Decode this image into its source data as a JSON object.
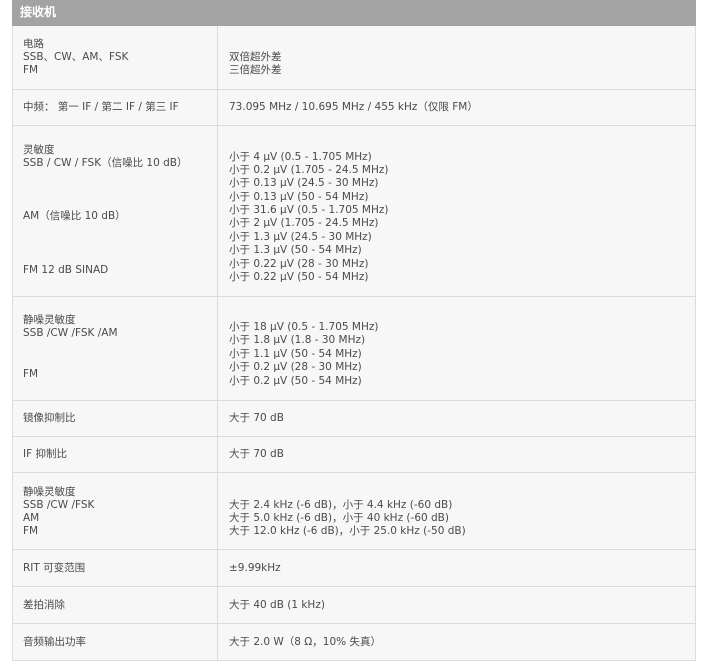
{
  "section_title": "接收机",
  "rows": [
    {
      "label": [
        "电路",
        "SSB、CW、AM、FSK",
        "FM"
      ],
      "value": [
        "双倍超外差",
        "三倍超外差"
      ]
    },
    {
      "label": [
        "中频： 第一 IF / 第二 IF / 第三 IF"
      ],
      "value": [
        "73.095 MHz / 10.695 MHz / 455 kHz（仅限 FM）"
      ]
    },
    {
      "label": [
        "灵敏度",
        "SSB / CW / FSK（信噪比 10 dB）",
        "AM（信噪比 10 dB）",
        "FM 12 dB SINAD"
      ],
      "value": [
        "小于 4 μV (0.5 - 1.705 MHz)",
        "小于 0.2 μV (1.705 - 24.5 MHz)",
        "小于 0.13 μV (24.5 - 30 MHz)",
        "小于 0.13 μV (50 - 54 MHz)",
        "小于 31.6 μV (0.5 - 1.705 MHz)",
        "小于 2 μV (1.705 - 24.5 MHz)",
        "小于 1.3 μV (24.5 - 30 MHz)",
        "小于 1.3 μV (50 - 54 MHz)",
        "小于 0.22 μV (28 - 30 MHz)",
        "小于 0.22 μV (50 - 54 MHz)"
      ]
    },
    {
      "label": [
        "静噪灵敏度",
        "SSB /CW /FSK /AM",
        "FM"
      ],
      "value": [
        "小于 18 μV (0.5 - 1.705 MHz)",
        "小于 1.8 μV (1.8 - 30 MHz)",
        "小于 1.1 μV (50 - 54 MHz)",
        "小于 0.2 μV (28 - 30 MHz)",
        "小于 0.2 μV (50 - 54 MHz)"
      ]
    },
    {
      "label": [
        "镜像抑制比"
      ],
      "value": [
        "大于 70 dB"
      ]
    },
    {
      "label": [
        "IF 抑制比"
      ],
      "value": [
        "大于 70 dB"
      ]
    },
    {
      "label": [
        "静噪灵敏度",
        "SSB /CW /FSK",
        "AM",
        "FM"
      ],
      "value": [
        "大于 2.4 kHz (-6 dB)，小于 4.4 kHz (-60 dB)",
        "大于 5.0 kHz (-6 dB)，小于 40 kHz (-60 dB)",
        "大于 12.0 kHz (-6 dB)，小于 25.0 kHz (-50 dB)"
      ]
    },
    {
      "label": [
        "RIT 可变范围"
      ],
      "value": [
        "±9.99kHz"
      ]
    },
    {
      "label": [
        "差拍消除"
      ],
      "value": [
        "大于 40 dB (1 kHz)"
      ]
    },
    {
      "label": [
        "音频输出功率"
      ],
      "value": [
        "大于 2.0 W（8 Ω，10% 失真）"
      ]
    }
  ]
}
